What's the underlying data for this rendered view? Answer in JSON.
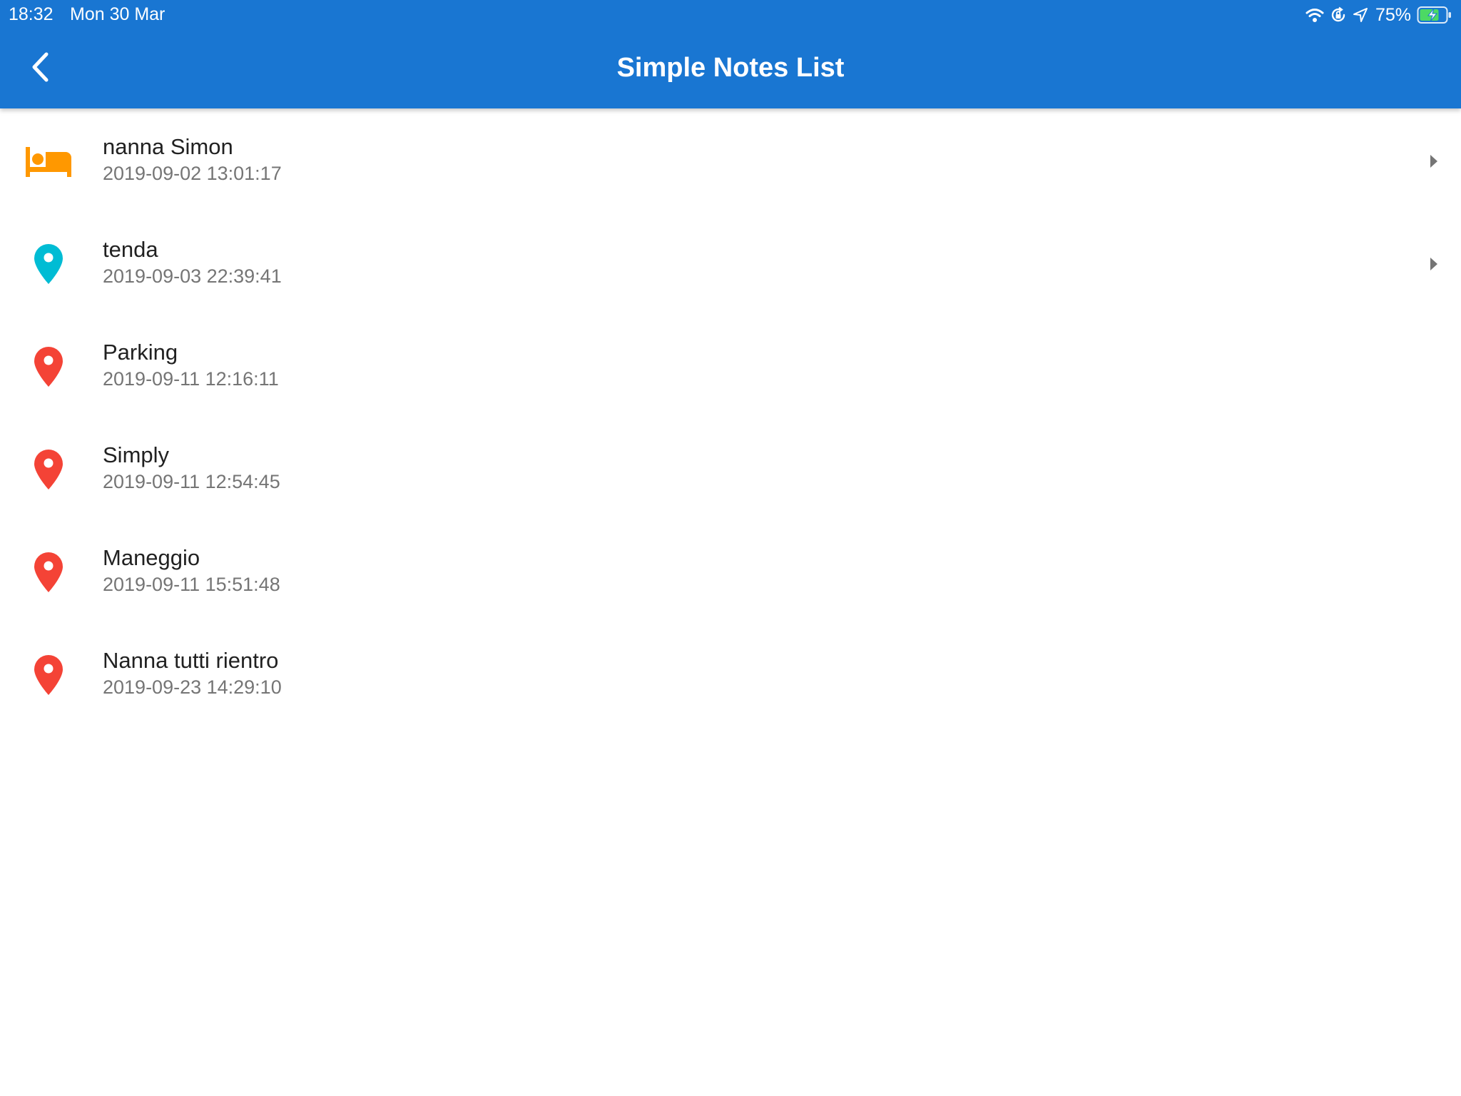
{
  "status_bar": {
    "time": "18:32",
    "date": "Mon 30 Mar",
    "battery_percent": "75%",
    "icons": [
      "wifi-icon",
      "orientation-lock-icon",
      "location-arrow-icon",
      "battery-charging-icon"
    ]
  },
  "app_bar": {
    "title": "Simple Notes List",
    "back_icon": "chevron-left-icon",
    "background_color": "#1976D2"
  },
  "notes": [
    {
      "title": "nanna Simon",
      "timestamp": "2019-09-02 13:01:17",
      "icon": "bed-icon",
      "icon_color": "#FF9800",
      "has_chevron": true
    },
    {
      "title": "tenda",
      "timestamp": "2019-09-03 22:39:41",
      "icon": "location-pin-icon",
      "icon_color": "#00BCD4",
      "has_chevron": true
    },
    {
      "title": "Parking",
      "timestamp": "2019-09-11 12:16:11",
      "icon": "location-pin-icon",
      "icon_color": "#F44336",
      "has_chevron": false
    },
    {
      "title": "Simply",
      "timestamp": "2019-09-11 12:54:45",
      "icon": "location-pin-icon",
      "icon_color": "#F44336",
      "has_chevron": false
    },
    {
      "title": "Maneggio",
      "timestamp": "2019-09-11 15:51:48",
      "icon": "location-pin-icon",
      "icon_color": "#F44336",
      "has_chevron": false
    },
    {
      "title": "Nanna tutti rientro",
      "timestamp": "2019-09-23 14:29:10",
      "icon": "location-pin-icon",
      "icon_color": "#F44336",
      "has_chevron": false
    }
  ]
}
